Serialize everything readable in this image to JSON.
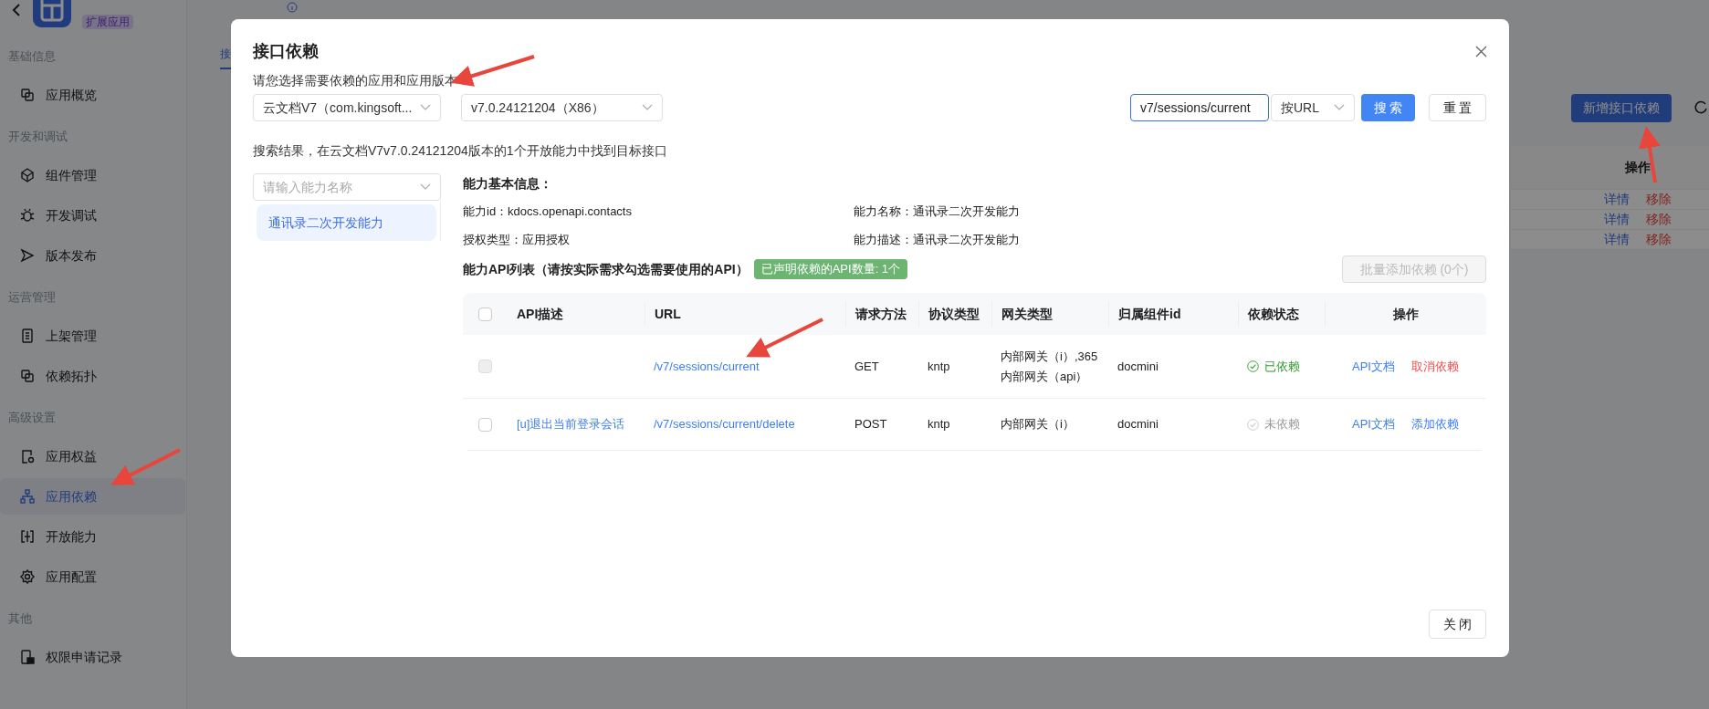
{
  "app": {
    "badge": "扩展应用"
  },
  "sidebar": {
    "sections": [
      {
        "title": "基础信息",
        "items": [
          {
            "label": "应用概览",
            "selected": false
          }
        ]
      },
      {
        "title": "开发和调试",
        "items": [
          {
            "label": "组件管理",
            "selected": false
          },
          {
            "label": "开发调试",
            "selected": false
          },
          {
            "label": "版本发布",
            "selected": false
          }
        ]
      },
      {
        "title": "运营管理",
        "items": [
          {
            "label": "上架管理",
            "selected": false
          },
          {
            "label": "依赖拓扑",
            "selected": false
          }
        ]
      },
      {
        "title": "高级设置",
        "items": [
          {
            "label": "应用权益",
            "selected": false
          },
          {
            "label": "应用依赖",
            "selected": true
          },
          {
            "label": "开放能力",
            "selected": false
          },
          {
            "label": "应用配置",
            "selected": false
          }
        ]
      },
      {
        "title": "其他",
        "items": [
          {
            "label": "权限申请记录",
            "selected": false
          }
        ]
      }
    ]
  },
  "page": {
    "tab": "接",
    "add_button": "新增接口依赖",
    "column_header": "操作",
    "rows": [
      {
        "detail": "详情",
        "remove": "移除"
      },
      {
        "detail": "详情",
        "remove": "移除"
      },
      {
        "detail": "详情",
        "remove": "移除"
      }
    ]
  },
  "dialog": {
    "title": "接口依赖",
    "prompt": "请您选择需要依赖的应用和应用版本：",
    "app_select": "云文档V7（com.kingsoft...",
    "version_select": "v7.0.24121204（X86）",
    "search": {
      "value": "v7/sessions/current",
      "mode": "按URL",
      "search_button": "搜 索",
      "reset_button": "重 置"
    },
    "result_text": "搜索结果，在云文档V7v7.0.24121204版本的1个开放能力中找到目标接口",
    "capability_filter": {
      "placeholder": "请输入能力名称"
    },
    "capabilities": [
      {
        "label": "通讯录二次开发能力",
        "selected": true
      }
    ],
    "info_title": "能力基本信息：",
    "info": [
      {
        "label": "能力id：",
        "value": "kdocs.openapi.contacts"
      },
      {
        "label": "能力名称：",
        "value": "通讯录二次开发能力"
      },
      {
        "label": "授权类型：",
        "value": "应用授权"
      },
      {
        "label": "能力描述：",
        "value": "通讯录二次开发能力"
      }
    ],
    "api_list_title": "能力API列表（请按实际需求勾选需要使用的API）",
    "declared_badge": "已声明依赖的API数量: 1个",
    "batch_button": "批量添加依赖 (0个)",
    "table": {
      "select_all": {
        "checked": false
      },
      "columns": [
        "API描述",
        "URL",
        "请求方法",
        "协议类型",
        "网关类型",
        "归属组件id",
        "依赖状态",
        "操作"
      ],
      "rows": [
        {
          "checked": false,
          "disabled": true,
          "description": "",
          "url": "/v7/sessions/current",
          "method": "GET",
          "protocol": "kntp",
          "gateway": [
            "内部网关（i）,365",
            "内部网关（api）"
          ],
          "component": "docmini",
          "status": {
            "kind": "depended",
            "label": "已依赖"
          },
          "actions": [
            {
              "kind": "link",
              "label": "API文档"
            },
            {
              "kind": "danger",
              "label": "取消依赖"
            }
          ]
        },
        {
          "checked": false,
          "disabled": false,
          "description": "[u]退出当前登录会话",
          "url": "/v7/sessions/current/delete",
          "method": "POST",
          "protocol": "kntp",
          "gateway": [
            "内部网关（i）"
          ],
          "component": "docmini",
          "status": {
            "kind": "not_depended",
            "label": "未依赖"
          },
          "actions": [
            {
              "kind": "link",
              "label": "API文档"
            },
            {
              "kind": "link",
              "label": "添加依赖"
            }
          ]
        }
      ]
    },
    "close_button": "关 闭"
  }
}
